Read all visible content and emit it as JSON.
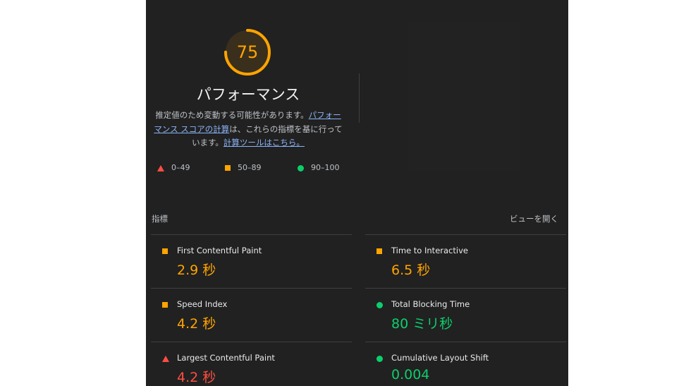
{
  "score": {
    "value": 75,
    "fraction": 0.75,
    "color": "#ffa400"
  },
  "category": {
    "title": "パフォーマンス"
  },
  "description": {
    "text1": "推定値のため変動する可能性があります。",
    "link1": "パフォーマンス スコアの計算",
    "text2": "は、これらの指標を基に行っています。",
    "link2": "計算ツールはこちら。"
  },
  "legend": [
    {
      "icon": "red-triangle-icon",
      "label": "0–49",
      "color": "#ff4e42"
    },
    {
      "icon": "orange-square-icon",
      "label": "50–89",
      "color": "#ffa400"
    },
    {
      "icon": "green-circle-icon",
      "label": "90–100",
      "color": "#0cce6b"
    }
  ],
  "metrics": {
    "heading": "指標",
    "expand_label": "ビューを開く",
    "left": [
      {
        "icon": "orange-square-icon",
        "name": "First Contentful Paint",
        "value": "2.9 秒",
        "rating": "average"
      },
      {
        "icon": "orange-square-icon",
        "name": "Speed Index",
        "value": "4.2 秒",
        "rating": "average"
      },
      {
        "icon": "red-triangle-icon",
        "name": "Largest Contentful Paint",
        "value": "4.2 秒",
        "rating": "fail"
      }
    ],
    "right": [
      {
        "icon": "orange-square-icon",
        "name": "Time to Interactive",
        "value": "6.5 秒",
        "rating": "average"
      },
      {
        "icon": "green-circle-icon",
        "name": "Total Blocking Time",
        "value": "80 ミリ秒",
        "rating": "pass"
      },
      {
        "icon": "green-circle-icon",
        "name": "Cumulative Layout Shift",
        "value": "0.004",
        "rating": "pass"
      }
    ]
  }
}
